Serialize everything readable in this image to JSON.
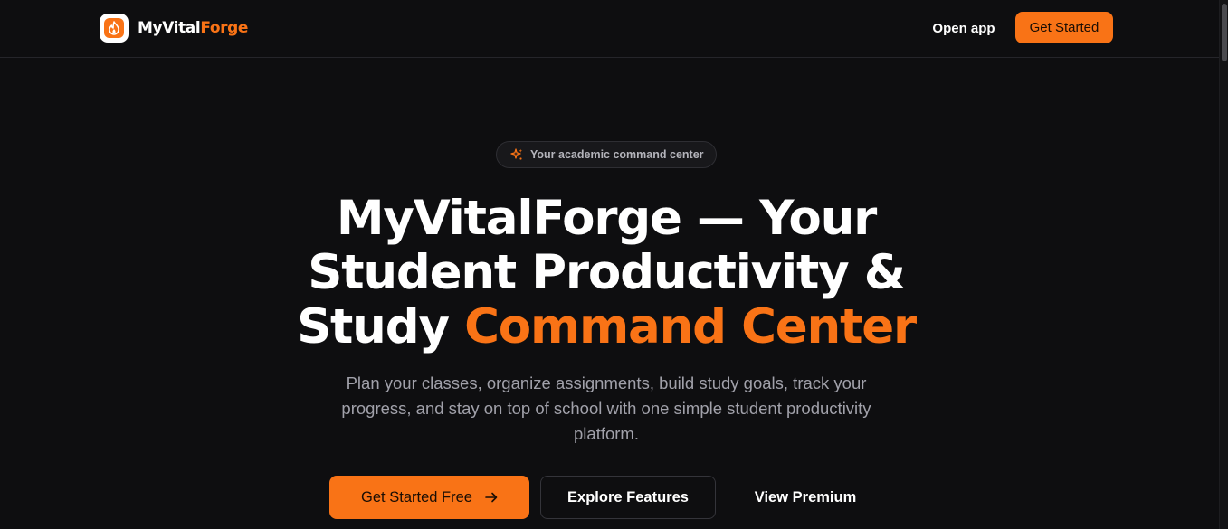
{
  "brand": {
    "name_part1": "MyVital",
    "name_part2": "Forge",
    "logo_icon": "flame-icon",
    "accent_color": "#f97316",
    "background_color": "#0e0e10"
  },
  "nav": {
    "open_app_label": "Open app",
    "get_started_label": "Get Started"
  },
  "hero": {
    "badge": {
      "icon": "sparkles-icon",
      "text": "Your academic command center"
    },
    "headline": {
      "line1": "MyVitalForge — Your",
      "line2": "Student Productivity &",
      "line3_plain": "Study ",
      "line3_accent": "Command Center"
    },
    "subtext": {
      "line1": "Plan your classes, organize assignments, build study goals, track your",
      "line2": "progress, and stay on top of school with one simple student productivity",
      "line3": "platform."
    },
    "buttons": {
      "primary_label": "Get Started Free",
      "primary_icon": "arrow-right-icon",
      "secondary_label": "Explore Features",
      "tertiary_label": "View Premium"
    }
  }
}
